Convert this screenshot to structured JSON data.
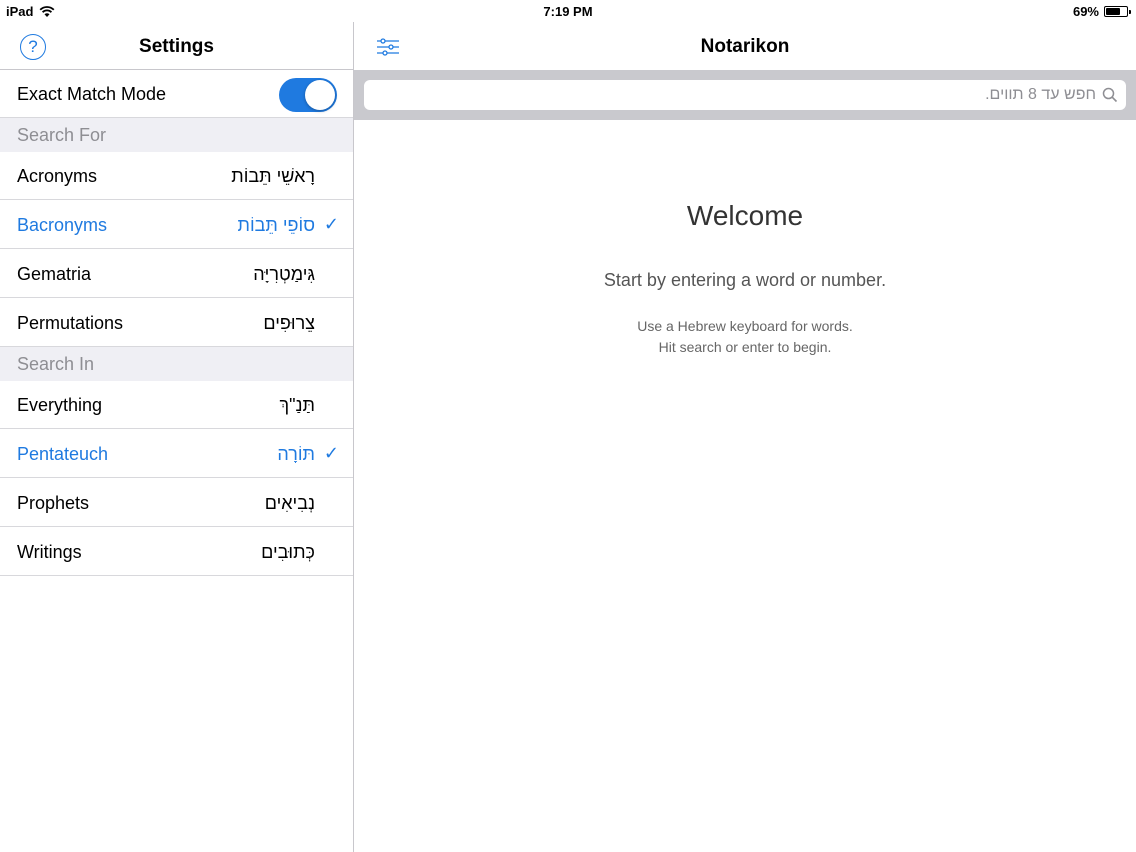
{
  "status_bar": {
    "device": "iPad",
    "time": "7:19 PM",
    "battery": "69%",
    "battery_level": 0.69,
    "wifi_icon": "wifi-icon"
  },
  "settings": {
    "title": "Settings",
    "help_label": "?",
    "exact_match": {
      "label": "Exact Match Mode",
      "on": true
    },
    "search_for": {
      "header": "Search For",
      "items": [
        {
          "label": "Acronyms",
          "hebrew": "רָאשֵׁי תֵּבוֹת",
          "selected": false
        },
        {
          "label": "Bacronyms",
          "hebrew": "סוֹפֵי תֵּבוֹת",
          "selected": true
        },
        {
          "label": "Gematria",
          "hebrew": "גִּימַטְרִיָּה",
          "selected": false
        },
        {
          "label": "Permutations",
          "hebrew": "צֵרוּפִים",
          "selected": false
        }
      ]
    },
    "search_in": {
      "header": "Search In",
      "items": [
        {
          "label": "Everything",
          "hebrew": "תַּנַ\"ךְ",
          "selected": false
        },
        {
          "label": "Pentateuch",
          "hebrew": "תּוֹרָה",
          "selected": true
        },
        {
          "label": "Prophets",
          "hebrew": "נְבִיאִים",
          "selected": false
        },
        {
          "label": "Writings",
          "hebrew": "כְּתוּבִים",
          "selected": false
        }
      ]
    },
    "check_glyph": "✓"
  },
  "main": {
    "title": "Notarikon",
    "search_placeholder": "חפש עד 8 תווים.",
    "welcome": "Welcome",
    "start": "Start by entering a word or number.",
    "hint_line1": "Use a Hebrew keyboard for words.",
    "hint_line2": "Hit search or enter to begin."
  },
  "colors": {
    "accent": "#1f7ae0",
    "section_bg": "#efeff4",
    "searchbar_bg": "#c9c9ce"
  }
}
